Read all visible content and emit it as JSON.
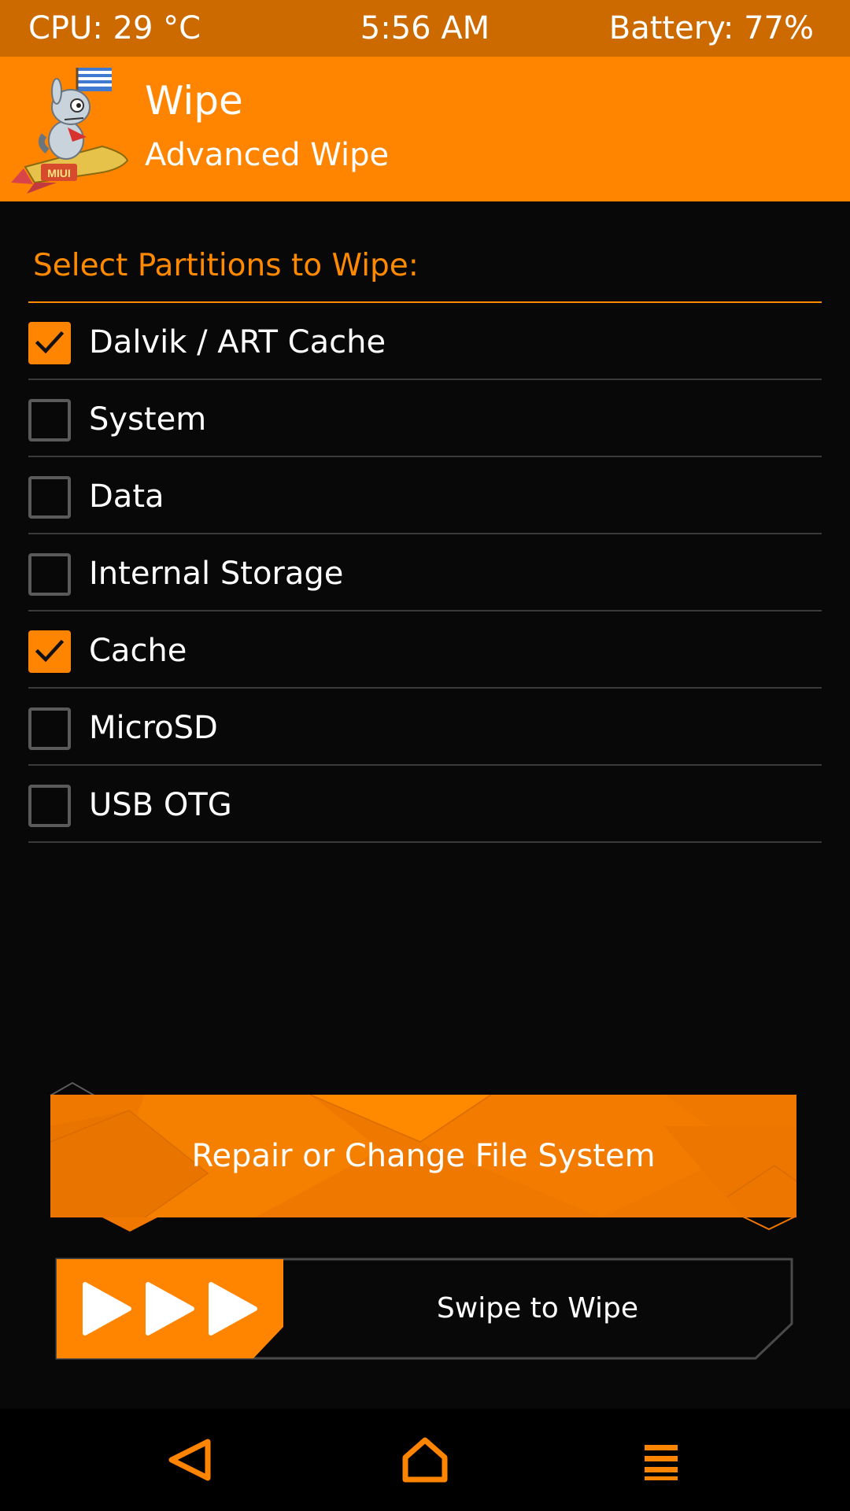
{
  "status_bar": {
    "cpu": "CPU: 29 °C",
    "time": "5:56 AM",
    "battery": "Battery: 77%"
  },
  "header": {
    "title": "Wipe",
    "subtitle": "Advanced Wipe",
    "logo_icon": "miui-rocket-mascot-logo",
    "logo_text": "MIUI"
  },
  "partitions": {
    "title": "Select Partitions to Wipe:",
    "items": [
      {
        "label": "Dalvik / ART Cache",
        "checked": true
      },
      {
        "label": "System",
        "checked": false
      },
      {
        "label": "Data",
        "checked": false
      },
      {
        "label": "Internal Storage",
        "checked": false
      },
      {
        "label": "Cache",
        "checked": true
      },
      {
        "label": "MicroSD",
        "checked": false
      },
      {
        "label": "USB OTG",
        "checked": false
      }
    ]
  },
  "repair_button": {
    "label": "Repair or Change File System"
  },
  "swipe": {
    "label": "Swipe to Wipe",
    "handle_icon": "triple-play-arrows-icon"
  },
  "nav": {
    "back_icon": "back-triangle-icon",
    "home_icon": "home-icon",
    "menu_icon": "menu-icon"
  },
  "colors": {
    "accent": "#ff8400",
    "status_bar": "#cc6a00",
    "background": "#080808",
    "divider": "#3a3a3a",
    "checkbox_border": "#5a5a5a"
  }
}
